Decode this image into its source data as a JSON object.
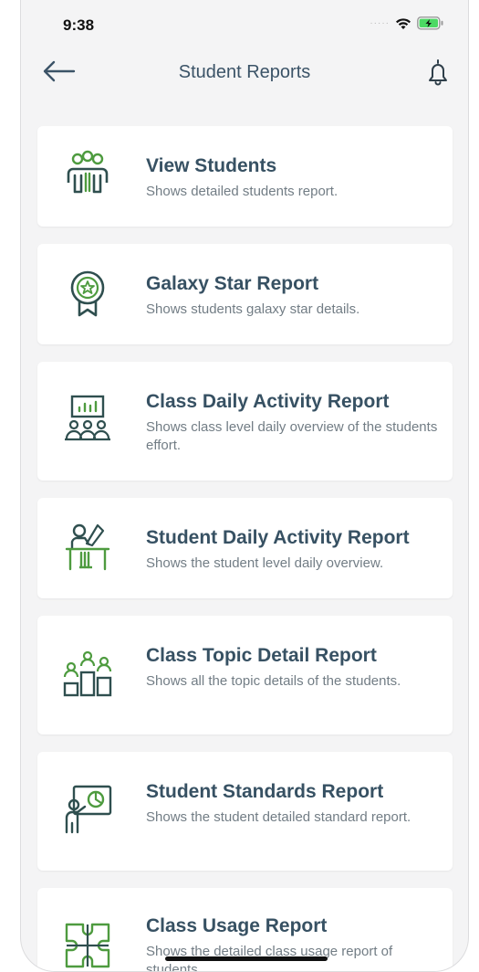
{
  "status_bar": {
    "time": "9:38",
    "signal": "·····"
  },
  "nav": {
    "title": "Student Reports"
  },
  "colors": {
    "accent_green": "#4e9b3f",
    "dark_icon": "#2f4f4f",
    "title_text": "#375163"
  },
  "reports": [
    {
      "title": "View Students",
      "description": "Shows detailed students report.",
      "icon": "students-group-icon"
    },
    {
      "title": "Galaxy Star Report",
      "description": "Shows students galaxy star details.",
      "icon": "star-badge-icon"
    },
    {
      "title": "Class Daily Activity Report",
      "description": "Shows  class level daily overview of the students effort.",
      "icon": "classroom-board-icon"
    },
    {
      "title": "Student Daily Activity Report",
      "description": "Shows the student level daily overview.",
      "icon": "student-desk-icon"
    },
    {
      "title": "Class Topic Detail Report",
      "description": "Shows all the topic details of the students.",
      "icon": "podium-students-icon"
    },
    {
      "title": "Student Standards Report",
      "description": "Shows the student detailed standard report.",
      "icon": "presenter-board-icon"
    },
    {
      "title": "Class Usage Report",
      "description": "Shows the detailed class usage report of students.",
      "icon": "puzzle-icon"
    }
  ]
}
